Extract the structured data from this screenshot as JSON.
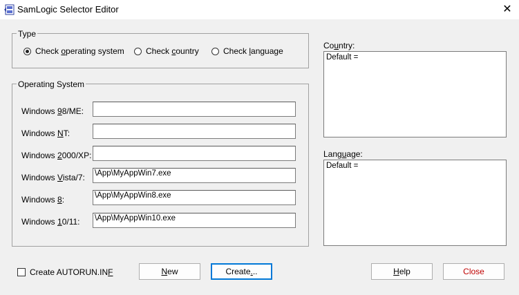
{
  "window": {
    "title": "SamLogic Selector Editor",
    "close_glyph": "✕"
  },
  "type_group": {
    "label": "Type",
    "options": [
      {
        "pre": "Check ",
        "u": "o",
        "post": "perating system",
        "selected": true
      },
      {
        "pre": "Check ",
        "u": "c",
        "post": "ountry",
        "selected": false
      },
      {
        "pre": "Check ",
        "u": "l",
        "post": "anguage",
        "selected": false
      }
    ]
  },
  "os_group": {
    "label": "Operating System",
    "rows": [
      {
        "pre": "Windows ",
        "u": "9",
        "post": "8/ME:",
        "value": ""
      },
      {
        "pre": "Windows ",
        "u": "N",
        "post": "T:",
        "value": ""
      },
      {
        "pre": "Windows ",
        "u": "2",
        "post": "000/XP:",
        "value": ""
      },
      {
        "pre": "Windows ",
        "u": "V",
        "post": "ista/7:",
        "value": "\\App\\MyAppWin7.exe"
      },
      {
        "pre": "Windows ",
        "u": "8",
        "post": ":",
        "value": "\\App\\MyAppWin8.exe"
      },
      {
        "pre": "Windows ",
        "u": "1",
        "post": "0/11:",
        "value": "\\App\\MyAppWin10.exe"
      }
    ]
  },
  "country": {
    "pre": "Co",
    "u": "u",
    "post": "ntry:",
    "value": "Default ="
  },
  "language": {
    "pre": "Lang",
    "u": "u",
    "post": "age:",
    "value": "Default ="
  },
  "autorun": {
    "pre": "Create AUTORUN.IN",
    "u": "F",
    "post": "",
    "checked": false
  },
  "buttons": {
    "new": {
      "pre": "",
      "u": "N",
      "post": "ew"
    },
    "create": {
      "pre": "Create",
      "u": ".",
      "post": ".."
    },
    "help": {
      "pre": "",
      "u": "H",
      "post": "elp"
    },
    "close": {
      "label": "Close",
      "color": "#c00000"
    }
  }
}
